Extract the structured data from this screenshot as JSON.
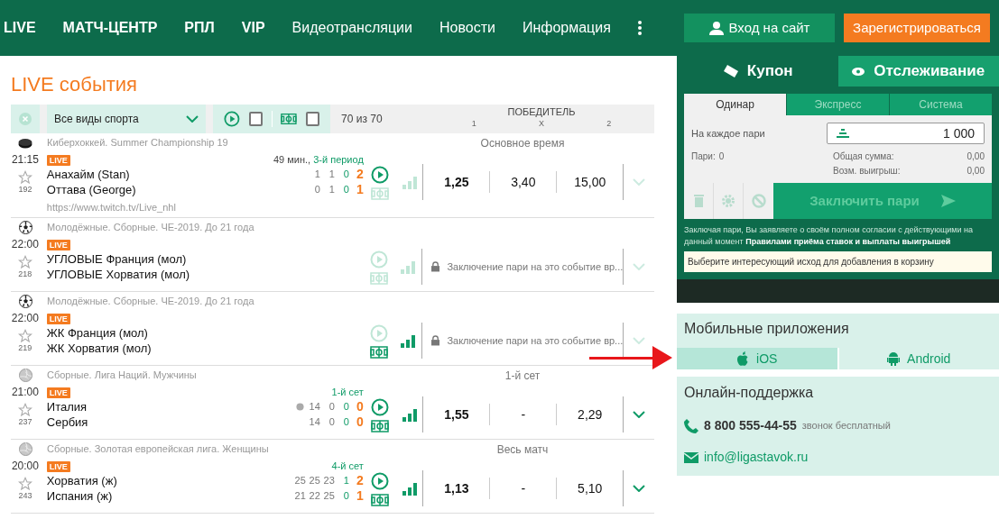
{
  "nav": {
    "items": [
      {
        "label": "LIVE",
        "bold": true
      },
      {
        "label": "МАТЧ-ЦЕНТР",
        "bold": true
      },
      {
        "label": "РПЛ",
        "bold": true
      },
      {
        "label": "VIP",
        "bold": true
      },
      {
        "label": "Видеотрансляции",
        "bold": false
      },
      {
        "label": "Новости",
        "bold": false
      },
      {
        "label": "Информация",
        "bold": false
      }
    ],
    "login": "Вход на сайт",
    "register": "Зарегистрироваться"
  },
  "title": "LIVE события",
  "filter": {
    "sport": "Все виды спорта",
    "video_checked": false,
    "stats_checked": false,
    "count": "70 из 70",
    "market": "ПОБЕДИТЕЛЬ",
    "outcomes": [
      "1",
      "X",
      "2"
    ]
  },
  "events": [
    {
      "kind": "hockey",
      "league": "Киберхоккей. Summer Championship 19",
      "time": "21:15",
      "count": "192",
      "badge": "LIVE",
      "status": "49 мин.,",
      "period": "3-й период",
      "teams": [
        {
          "name": "Анахайм (Stan)",
          "serving": false,
          "scores": [
            {
              "value": "1",
              "kind": "past"
            },
            {
              "value": "1",
              "kind": "past"
            },
            {
              "value": "0",
              "kind": "current"
            },
            {
              "value": "2",
              "kind": "total"
            }
          ]
        },
        {
          "name": "Оттава (George)",
          "serving": false,
          "scores": [
            {
              "value": "0",
              "kind": "past"
            },
            {
              "value": "1",
              "kind": "past"
            },
            {
              "value": "0",
              "kind": "current"
            },
            {
              "value": "1",
              "kind": "total"
            }
          ]
        }
      ],
      "link": "https://www.twitch.tv/Live_nhl",
      "market": "Основное время",
      "video": true,
      "stats": false,
      "signal": false,
      "odds": [
        {
          "value": "1,25",
          "favorite": true
        },
        {
          "value": "3,40",
          "favorite": false
        },
        {
          "value": "15,00",
          "favorite": false
        }
      ],
      "expandable": false
    },
    {
      "kind": "football",
      "league": "Молодёжные. Сборные. ЧЕ-2019. До 21 года",
      "time": "22:00",
      "count": "218",
      "badge": "LIVE",
      "teams": [
        {
          "name": "УГЛОВЫЕ Франция (мол)",
          "serving": false
        },
        {
          "name": "УГЛОВЫЕ Хорватия (мол)",
          "serving": false
        }
      ],
      "video": false,
      "stats": false,
      "signal": false,
      "locked": "Заключение пари на это событие вр...",
      "expandable": false
    },
    {
      "kind": "football",
      "league": "Молодёжные. Сборные. ЧЕ-2019. До 21 года",
      "time": "22:00",
      "count": "219",
      "badge": "LIVE",
      "teams": [
        {
          "name": "ЖК Франция (мол)",
          "serving": false
        },
        {
          "name": "ЖК Хорватия (мол)",
          "serving": false
        }
      ],
      "video": false,
      "stats": true,
      "signal": true,
      "locked": "Заключение пари на это событие вр...",
      "expandable": false
    },
    {
      "kind": "volleyball",
      "league": "Сборные. Лига Наций. Мужчины",
      "time": "21:00",
      "count": "237",
      "badge": "LIVE",
      "period": "1-й сет",
      "teams": [
        {
          "name": "Италия",
          "serving": true,
          "scores": [
            {
              "value": "14",
              "kind": "past"
            },
            {
              "value": "0",
              "kind": "past"
            },
            {
              "value": "0",
              "kind": "current"
            },
            {
              "value": "0",
              "kind": "total"
            }
          ]
        },
        {
          "name": "Сербия",
          "serving": false,
          "scores": [
            {
              "value": "14",
              "kind": "past"
            },
            {
              "value": "0",
              "kind": "past"
            },
            {
              "value": "0",
              "kind": "current"
            },
            {
              "value": "0",
              "kind": "total"
            }
          ]
        }
      ],
      "market": "1-й сет",
      "video": true,
      "stats": true,
      "signal": true,
      "odds": [
        {
          "value": "1,55",
          "favorite": true
        },
        {
          "value": "-",
          "favorite": false
        },
        {
          "value": "2,29",
          "favorite": false
        }
      ],
      "expandable": true
    },
    {
      "kind": "volleyball",
      "league": "Сборные. Золотая европейская лига. Женщины",
      "time": "20:00",
      "count": "243",
      "badge": "LIVE",
      "period": "4-й сет",
      "teams": [
        {
          "name": "Хорватия (ж)",
          "serving": false,
          "scores": [
            {
              "value": "25",
              "kind": "past"
            },
            {
              "value": "25",
              "kind": "past"
            },
            {
              "value": "23",
              "kind": "past"
            },
            {
              "value": "1",
              "kind": "current"
            },
            {
              "value": "2",
              "kind": "total"
            }
          ]
        },
        {
          "name": "Испания (ж)",
          "serving": false,
          "scores": [
            {
              "value": "21",
              "kind": "past"
            },
            {
              "value": "22",
              "kind": "past"
            },
            {
              "value": "25",
              "kind": "past"
            },
            {
              "value": "0",
              "kind": "current"
            },
            {
              "value": "1",
              "kind": "total"
            }
          ]
        }
      ],
      "market": "Весь матч",
      "video": true,
      "stats": true,
      "signal": true,
      "odds": [
        {
          "value": "1,13",
          "favorite": true
        },
        {
          "value": "-",
          "favorite": false
        },
        {
          "value": "5,10",
          "favorite": false
        }
      ],
      "expandable": true
    }
  ],
  "coupon": {
    "tabs": [
      {
        "label": "Купон",
        "selected": true
      },
      {
        "label": "Отслеживание",
        "selected": false
      }
    ],
    "modes": [
      {
        "label": "Одинар",
        "selected": true
      },
      {
        "label": "Экспресс",
        "selected": false
      },
      {
        "label": "Система",
        "selected": false
      }
    ],
    "stake_label": "На каждое пари",
    "stake": "1 000",
    "bets_label": "Пари:",
    "bets": "0",
    "total_label": "Общая сумма:",
    "total": "0,00",
    "win_label": "Возм. выигрыш:",
    "win": "0,00",
    "submit": "Заключить пари",
    "disclaimer": "Заключая пари, Вы заявляете о своём полном согласии с действующими на данный момент",
    "rules_link": "Правилами приёма ставок и выплаты выигрышей",
    "hint": "Выберите интересующий исход для добавления в корзину"
  },
  "apps": {
    "title": "Мобильные приложения",
    "items": [
      {
        "label": "iOS",
        "kind": "ios",
        "selected": true
      },
      {
        "label": "Android",
        "kind": "android",
        "selected": false
      }
    ]
  },
  "support": {
    "title": "Онлайн-поддержка",
    "phone": "8 800 555-44-55",
    "phone_note": "звонок бесплатный",
    "email": "info@ligastavok.ru"
  }
}
